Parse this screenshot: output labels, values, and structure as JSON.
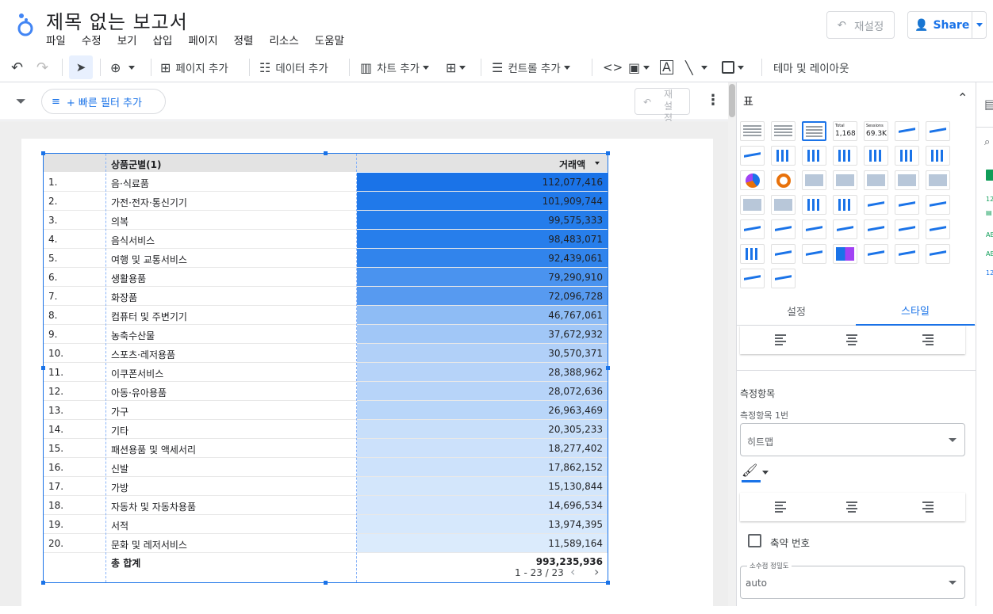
{
  "header": {
    "title": "제목 없는 보고서",
    "menu": [
      "파일",
      "수정",
      "보기",
      "삽입",
      "페이지",
      "정렬",
      "리소스",
      "도움말"
    ],
    "reset_label": "재설정",
    "share_label": "Share"
  },
  "toolbar": {
    "add_page": "페이지 추가",
    "add_data": "데이터 추가",
    "add_chart": "차트 추가",
    "add_control": "컨트롤 추가",
    "theme_layout": "테마 및 레이아웃"
  },
  "filterbar": {
    "quick_filter": "+ 빠른 필터 추가",
    "reset": "재설정"
  },
  "table": {
    "header_category": "상품군별(1)",
    "header_value": "거래액",
    "rows": [
      {
        "idx": "1.",
        "cat": "음·식료품",
        "val": "112,077,416",
        "shade": "#1a73e8"
      },
      {
        "idx": "2.",
        "cat": "가전·전자·통신기기",
        "val": "101,909,744",
        "shade": "#2079ea"
      },
      {
        "idx": "3.",
        "cat": "의복",
        "val": "99,575,333",
        "shade": "#257deb"
      },
      {
        "idx": "4.",
        "cat": "음식서비스",
        "val": "98,483,071",
        "shade": "#277eeb"
      },
      {
        "idx": "5.",
        "cat": "여행 및 교통서비스",
        "val": "92,439,061",
        "shade": "#3184ec"
      },
      {
        "idx": "6.",
        "cat": "생활용품",
        "val": "79,290,910",
        "shade": "#4a93ef"
      },
      {
        "idx": "7.",
        "cat": "화장품",
        "val": "72,096,728",
        "shade": "#579af0"
      },
      {
        "idx": "8.",
        "cat": "컴퓨터 및 주변기기",
        "val": "46,767,061",
        "shade": "#8ebcf5"
      },
      {
        "idx": "9.",
        "cat": "농축수산물",
        "val": "37,672,932",
        "shade": "#a1c7f7"
      },
      {
        "idx": "10.",
        "cat": "스포츠·레저용품",
        "val": "30,570,371",
        "shade": "#b1d0f8"
      },
      {
        "idx": "11.",
        "cat": "이쿠폰서비스",
        "val": "28,388,962",
        "shade": "#b6d3f9"
      },
      {
        "idx": "12.",
        "cat": "아동·유아용품",
        "val": "28,072,636",
        "shade": "#b7d4f9"
      },
      {
        "idx": "13.",
        "cat": "가구",
        "val": "26,963,469",
        "shade": "#b9d6f9"
      },
      {
        "idx": "14.",
        "cat": "기타",
        "val": "20,305,233",
        "shade": "#c8dffa"
      },
      {
        "idx": "15.",
        "cat": "패션용품 및 액세서리",
        "val": "18,277,402",
        "shade": "#cce1fb"
      },
      {
        "idx": "16.",
        "cat": "신발",
        "val": "17,862,152",
        "shade": "#cde2fb"
      },
      {
        "idx": "17.",
        "cat": "가방",
        "val": "15,130,844",
        "shade": "#d3e6fb"
      },
      {
        "idx": "18.",
        "cat": "자동차 및 자동차용품",
        "val": "14,696,534",
        "shade": "#d4e6fc"
      },
      {
        "idx": "19.",
        "cat": "서적",
        "val": "13,974,395",
        "shade": "#d6e8fc"
      },
      {
        "idx": "20.",
        "cat": "문화 및 레저서비스",
        "val": "11,589,164",
        "shade": "#dbebfc"
      }
    ],
    "total_label": "총 합계",
    "total_value": "993,235,936",
    "pagination": "1 - 23 / 23"
  },
  "panel": {
    "title": "표",
    "tab_setup": "설정",
    "tab_style": "스타일",
    "metric_section": "측정항목",
    "metric1_label": "측정항목 1번",
    "metric1_value": "히트맵",
    "compact_numbers": "축약 번호",
    "decimal_label": "소수점 정밀도",
    "decimal_value": "auto",
    "scorecard_total": "Total",
    "scorecard_total_value": "1,168",
    "scorecard_sessions": "Sessions",
    "scorecard_sessions_value": "69.3K"
  },
  "colors": {
    "accent": "#1a73e8"
  }
}
